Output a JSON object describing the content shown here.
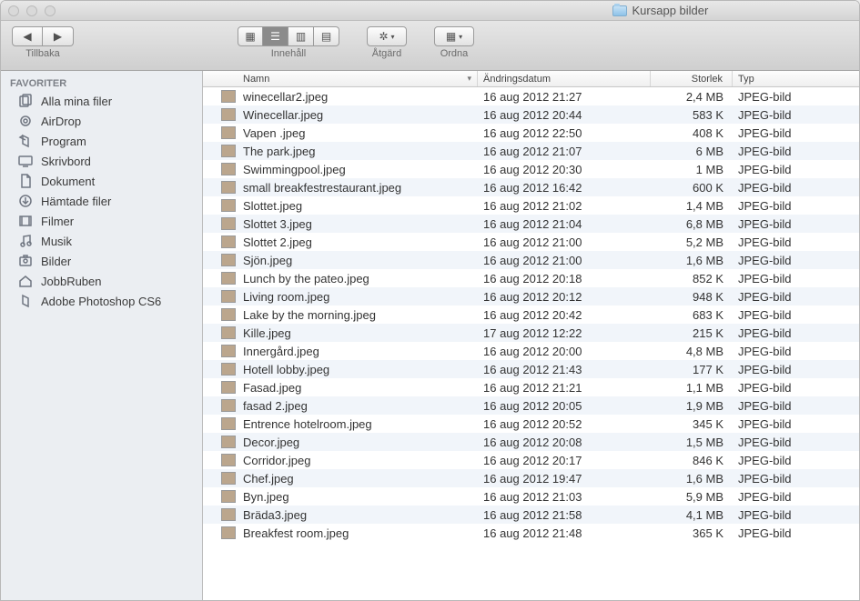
{
  "window": {
    "title": "Kursapp bilder"
  },
  "toolbar": {
    "back_label": "Tillbaka",
    "view_label": "Innehåll",
    "action_label": "Åtgärd",
    "arrange_label": "Ordna"
  },
  "sidebar": {
    "header": "FAVORITER",
    "items": [
      {
        "label": "Alla mina filer",
        "icon": "all-files-icon"
      },
      {
        "label": "AirDrop",
        "icon": "airdrop-icon"
      },
      {
        "label": "Program",
        "icon": "applications-icon"
      },
      {
        "label": "Skrivbord",
        "icon": "desktop-icon"
      },
      {
        "label": "Dokument",
        "icon": "documents-icon"
      },
      {
        "label": "Hämtade filer",
        "icon": "downloads-icon"
      },
      {
        "label": "Filmer",
        "icon": "movies-icon"
      },
      {
        "label": "Musik",
        "icon": "music-icon"
      },
      {
        "label": "Bilder",
        "icon": "pictures-icon"
      },
      {
        "label": "JobbRuben",
        "icon": "home-icon"
      },
      {
        "label": "Adobe Photoshop CS6",
        "icon": "app-icon"
      }
    ]
  },
  "columns": {
    "name": "Namn",
    "date": "Ändringsdatum",
    "size": "Storlek",
    "type": "Typ"
  },
  "files": [
    {
      "name": "winecellar2.jpeg",
      "date": "16 aug 2012 21:27",
      "size": "2,4 MB",
      "type": "JPEG-bild"
    },
    {
      "name": "Winecellar.jpeg",
      "date": "16 aug 2012 20:44",
      "size": "583 K",
      "type": "JPEG-bild"
    },
    {
      "name": "Vapen .jpeg",
      "date": "16 aug 2012 22:50",
      "size": "408 K",
      "type": "JPEG-bild"
    },
    {
      "name": "The park.jpeg",
      "date": "16 aug 2012 21:07",
      "size": "6 MB",
      "type": "JPEG-bild"
    },
    {
      "name": "Swimmingpool.jpeg",
      "date": "16 aug 2012 20:30",
      "size": "1 MB",
      "type": "JPEG-bild"
    },
    {
      "name": "small breakfestrestaurant.jpeg",
      "date": "16 aug 2012 16:42",
      "size": "600 K",
      "type": "JPEG-bild"
    },
    {
      "name": "Slottet.jpeg",
      "date": "16 aug 2012 21:02",
      "size": "1,4 MB",
      "type": "JPEG-bild"
    },
    {
      "name": "Slottet 3.jpeg",
      "date": "16 aug 2012 21:04",
      "size": "6,8 MB",
      "type": "JPEG-bild"
    },
    {
      "name": "Slottet 2.jpeg",
      "date": "16 aug 2012 21:00",
      "size": "5,2 MB",
      "type": "JPEG-bild"
    },
    {
      "name": "Sjön.jpeg",
      "date": "16 aug 2012 21:00",
      "size": "1,6 MB",
      "type": "JPEG-bild"
    },
    {
      "name": "Lunch by the pateo.jpeg",
      "date": "16 aug 2012 20:18",
      "size": "852 K",
      "type": "JPEG-bild"
    },
    {
      "name": "Living room.jpeg",
      "date": "16 aug 2012 20:12",
      "size": "948 K",
      "type": "JPEG-bild"
    },
    {
      "name": "Lake by the morning.jpeg",
      "date": "16 aug 2012 20:42",
      "size": "683 K",
      "type": "JPEG-bild"
    },
    {
      "name": "Kille.jpeg",
      "date": "17 aug 2012 12:22",
      "size": "215 K",
      "type": "JPEG-bild"
    },
    {
      "name": "Innergård.jpeg",
      "date": "16 aug 2012 20:00",
      "size": "4,8 MB",
      "type": "JPEG-bild"
    },
    {
      "name": "Hotell lobby.jpeg",
      "date": "16 aug 2012 21:43",
      "size": "177 K",
      "type": "JPEG-bild"
    },
    {
      "name": "Fasad.jpeg",
      "date": "16 aug 2012 21:21",
      "size": "1,1 MB",
      "type": "JPEG-bild"
    },
    {
      "name": "fasad 2.jpeg",
      "date": "16 aug 2012 20:05",
      "size": "1,9 MB",
      "type": "JPEG-bild"
    },
    {
      "name": "Entrence hotelroom.jpeg",
      "date": "16 aug 2012 20:52",
      "size": "345 K",
      "type": "JPEG-bild"
    },
    {
      "name": "Decor.jpeg",
      "date": "16 aug 2012 20:08",
      "size": "1,5 MB",
      "type": "JPEG-bild"
    },
    {
      "name": "Corridor.jpeg",
      "date": "16 aug 2012 20:17",
      "size": "846 K",
      "type": "JPEG-bild"
    },
    {
      "name": "Chef.jpeg",
      "date": "16 aug 2012 19:47",
      "size": "1,6 MB",
      "type": "JPEG-bild"
    },
    {
      "name": "Byn.jpeg",
      "date": "16 aug 2012 21:03",
      "size": "5,9 MB",
      "type": "JPEG-bild"
    },
    {
      "name": "Bräda3.jpeg",
      "date": "16 aug 2012 21:58",
      "size": "4,1 MB",
      "type": "JPEG-bild"
    },
    {
      "name": "Breakfest room.jpeg",
      "date": "16 aug 2012 21:48",
      "size": "365 K",
      "type": "JPEG-bild"
    }
  ]
}
